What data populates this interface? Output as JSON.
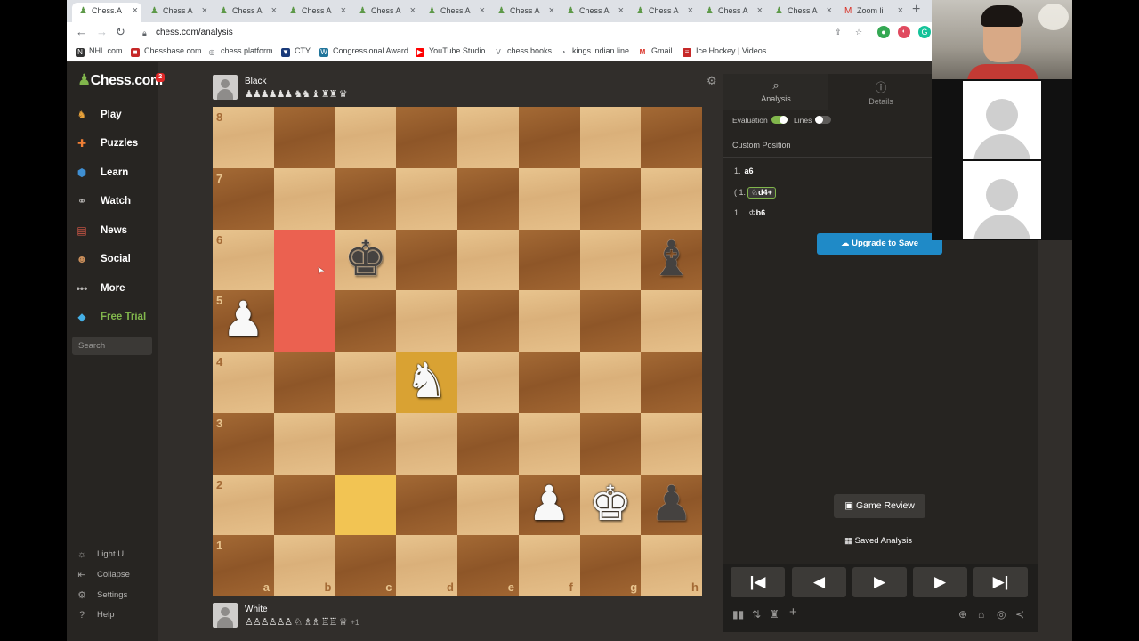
{
  "browser": {
    "tabs": [
      {
        "label": "Chess.A",
        "active": true
      },
      {
        "label": "Chess A"
      },
      {
        "label": "Chess A"
      },
      {
        "label": "Chess A"
      },
      {
        "label": "Chess A"
      },
      {
        "label": "Chess A"
      },
      {
        "label": "Chess A"
      },
      {
        "label": "Chess A"
      },
      {
        "label": "Chess A"
      },
      {
        "label": "Chess A"
      },
      {
        "label": "Chess A"
      },
      {
        "label": "Zoom li"
      }
    ],
    "url": "chess.com/analysis",
    "bookmarks": [
      "NHL.com",
      "Chessbase.com",
      "chess platform",
      "CTY",
      "Congressional Award",
      "YouTube Studio",
      "chess books",
      "kings indian line",
      "Gmail",
      "Ice Hockey | Videos..."
    ]
  },
  "sidebar": {
    "logo": "Chess.com",
    "logo_badge": "2",
    "items": [
      {
        "label": "Play",
        "icon": "play-icon",
        "color": "#e8a23a"
      },
      {
        "label": "Puzzles",
        "icon": "puzzle-icon",
        "color": "#f07f35"
      },
      {
        "label": "Learn",
        "icon": "learn-icon",
        "color": "#3f8fd2"
      },
      {
        "label": "Watch",
        "icon": "binoculars-icon",
        "color": "#b8b6b4"
      },
      {
        "label": "News",
        "icon": "news-icon",
        "color": "#d95a4a"
      },
      {
        "label": "Social",
        "icon": "social-icon",
        "color": "#c98e5a"
      },
      {
        "label": "More",
        "icon": "more-icon",
        "color": "#b8b6b4"
      },
      {
        "label": "Free Trial",
        "icon": "diamond-icon",
        "color": "#45b0e6"
      }
    ],
    "search_placeholder": "Search",
    "footer": [
      "Light UI",
      "Collapse",
      "Settings",
      "Help"
    ]
  },
  "players": {
    "top": {
      "name": "Black",
      "captured": "♟♟♟♟♟♟ ♞♞ ♝ ♜♜ ♛"
    },
    "bottom": {
      "name": "White",
      "captured": "♙♙♙♙♙♙ ♘ ♗♗ ♖♖ ♕",
      "advantage": "+1"
    }
  },
  "board": {
    "files": [
      "a",
      "b",
      "c",
      "d",
      "e",
      "f",
      "g",
      "h"
    ],
    "ranks": [
      "8",
      "7",
      "6",
      "5",
      "4",
      "3",
      "2",
      "1"
    ],
    "pieces": [
      {
        "square": "c6",
        "glyph": "♚",
        "color": "b",
        "name": "black-king"
      },
      {
        "square": "h6",
        "glyph": "♝",
        "color": "b",
        "name": "black-bishop"
      },
      {
        "square": "a5",
        "glyph": "♟",
        "color": "w",
        "name": "white-pawn"
      },
      {
        "square": "d4",
        "glyph": "♞",
        "color": "w",
        "name": "white-knight"
      },
      {
        "square": "f2",
        "glyph": "♟",
        "color": "w",
        "name": "white-pawn"
      },
      {
        "square": "g2",
        "glyph": "♚",
        "color": "w",
        "name": "white-king"
      },
      {
        "square": "h2",
        "glyph": "♟",
        "color": "b",
        "name": "black-pawn"
      }
    ],
    "highlights": [
      {
        "square": "b6",
        "kind": "red"
      },
      {
        "square": "b5",
        "kind": "red"
      },
      {
        "square": "d4",
        "kind": "yellow"
      },
      {
        "square": "c2",
        "kind": "yellow"
      }
    ]
  },
  "panel": {
    "tabs": [
      {
        "label": "Analysis",
        "icon": "magnifier-icon"
      },
      {
        "label": "Details",
        "icon": "info-icon"
      }
    ],
    "evaluation_label": "Evaluation",
    "lines_label": "Lines",
    "custom_position": "Custom Position",
    "moves": [
      {
        "num": "1.",
        "san": "a6"
      },
      {
        "num": "( 1.",
        "san": "♘d4+"
      },
      {
        "num": "1...",
        "san": "♔b6"
      }
    ],
    "upgrade_label": "Upgrade to Save",
    "game_review_label": "Game Review",
    "saved_analysis_label": "Saved Analysis",
    "controls": [
      "|◀",
      "◀",
      "▶",
      "▶",
      "▶|"
    ]
  },
  "colors": {
    "accent_green": "#81b64c",
    "upgrade_blue": "#1f8ac7",
    "highlight_red": "#eb6150",
    "highlight_yellow": "#f2c453"
  }
}
